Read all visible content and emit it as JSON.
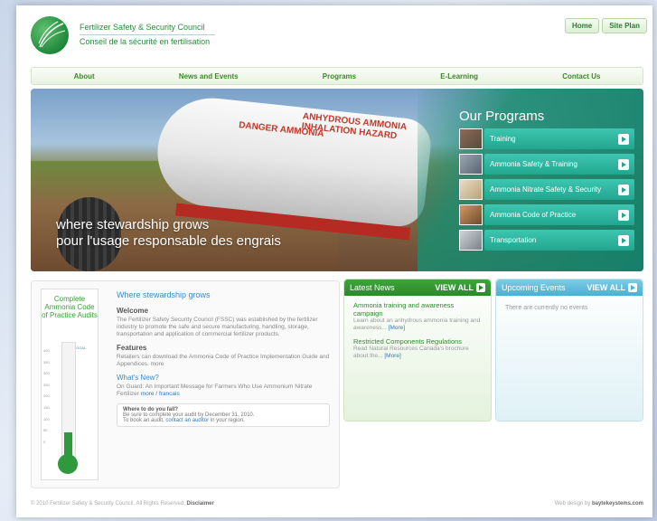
{
  "brand": {
    "name_en": "Fertilizer Safety & Security Council",
    "name_fr": "Conseil de la sécurité en fertilisation"
  },
  "toplinks": [
    "Home",
    "Site Plan"
  ],
  "nav": [
    "About",
    "News and Events",
    "Programs",
    "E-Learning",
    "Contact Us"
  ],
  "hero": {
    "tank_text_1": "DANGER AMMONIA",
    "tank_text_2": "ANHYDROUS AMMONIA INHALATION HAZARD",
    "tagline_en": "where stewardship grows",
    "tagline_fr": "pour l'usage responsable des engrais"
  },
  "programs": {
    "title": "Our Programs",
    "items": [
      {
        "label": "Training",
        "thumb": "training-photo"
      },
      {
        "label": "Ammonia Safety & Training",
        "thumb": "ammonia-truck-photo"
      },
      {
        "label": "Ammonia Nitrate Safety & Security",
        "thumb": "nitrate-bags-photo"
      },
      {
        "label": "Ammonia Code of Practice",
        "thumb": "worker-photo"
      },
      {
        "label": "Transportation",
        "thumb": "truck-photo"
      }
    ]
  },
  "thermometer": {
    "label": "Complete Ammonia Code of Practice Audits",
    "ticks": [
      "400",
      "350",
      "300",
      "250",
      "200",
      "150",
      "100",
      "50",
      "0"
    ],
    "goal_label": "GOAL",
    "fill_fraction": 0.12
  },
  "welcome": {
    "heading": "Where stewardship grows",
    "welcome_title": "Welcome",
    "welcome_text": "The Fertilizer Safety Security Council (FSSC) was established by the fertilizer industry to promote the safe and secure manufacturing, handling, storage, transportation and application of commercial fertilizer products.",
    "features_title": "Features",
    "features_text": "Retailers can download the Ammonia Code of Practice Implementation Guide and Appendices.",
    "features_more": "more",
    "whats_new_title": "What's New?",
    "whats_new_text": "On Guard: An Important Message for Farmers Who Use Ammonium Nitrate Fertilizer",
    "whats_new_link": "more / francais",
    "fall_title": "Where to do you fall?",
    "fall_text1": "Be sure to complete your audit by December 31, 2010.",
    "fall_text2": "To book an audit,",
    "fall_link": "contact an auditor",
    "fall_text3": "in your region."
  },
  "news": {
    "title": "Latest News",
    "view_all": "VIEW ALL",
    "items": [
      {
        "title": "Ammonia training and awareness campaign",
        "text": "Learn about an anhydrous ammonia training and awareness...",
        "more": "[More]"
      },
      {
        "title": "Restricted Components Regulations",
        "text": "Read Natural Resources Canada's brochure about the...",
        "more": "[More]"
      }
    ]
  },
  "events": {
    "title": "Upcoming Events",
    "view_all": "VIEW ALL",
    "empty": "There are currently no events"
  },
  "footer": {
    "copyright": "© 2010 Fertilizer Safety & Security Council. All Rights Reserved.",
    "disclaimer": "Disclaimer",
    "design": "Web design by",
    "designer": "baytekeystems.com"
  },
  "colors": {
    "brand_green": "#2d8a3c",
    "teal": "#23a690",
    "link_blue": "#2e7bbf",
    "events_blue": "#48b1d3"
  }
}
